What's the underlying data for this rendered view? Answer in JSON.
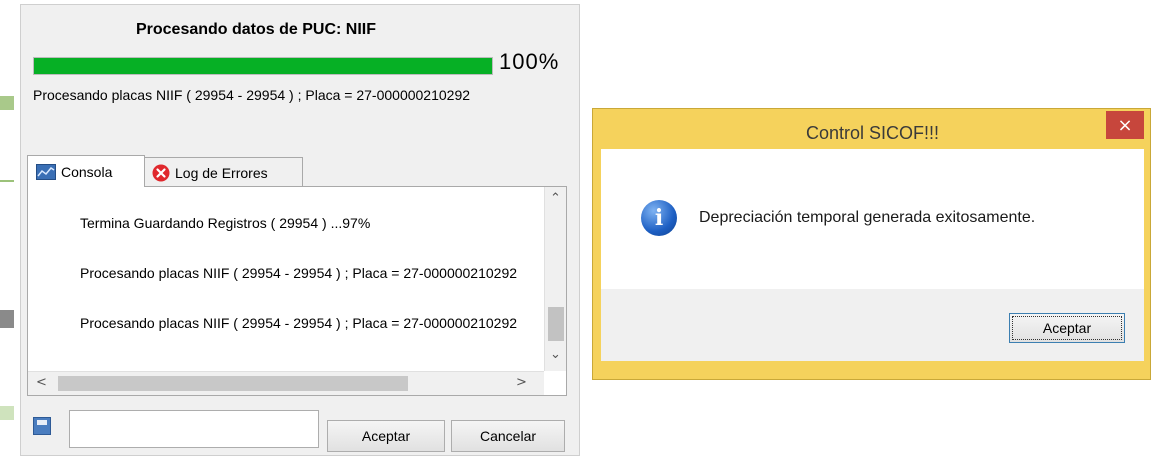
{
  "main_window": {
    "title": "Procesando datos de PUC: NIIF",
    "progress_percent": 100,
    "progress_label": "100%",
    "status_text": "Procesando placas NIIF ( 29954 - 29954 ) ; Placa = 27-000000210292",
    "progress_color": "#06b025"
  },
  "tabs": [
    {
      "label": "Consola",
      "icon": "console-icon",
      "active": true
    },
    {
      "label": "Log de Errores",
      "icon": "error-icon",
      "active": false
    }
  ],
  "console_lines": [
    "Termina Guardando Registros ( 29954 ) ...97%",
    "Procesando placas NIIF ( 29954 - 29954 ) ; Placa = 27-000000210292",
    "Procesando placas NIIF ( 29954 - 29954 ) ; Placa = 27-000000210292"
  ],
  "bottom_bar": {
    "path_value": "",
    "accept_label": "Aceptar",
    "cancel_label": "Cancelar"
  },
  "dialog": {
    "title": "Control SICOF!!!",
    "close_glyph": "×",
    "icon": "info-icon",
    "message": "Depreciación temporal generada exitosamente.",
    "accept_label": "Aceptar",
    "frame_color": "#f5d25c"
  }
}
